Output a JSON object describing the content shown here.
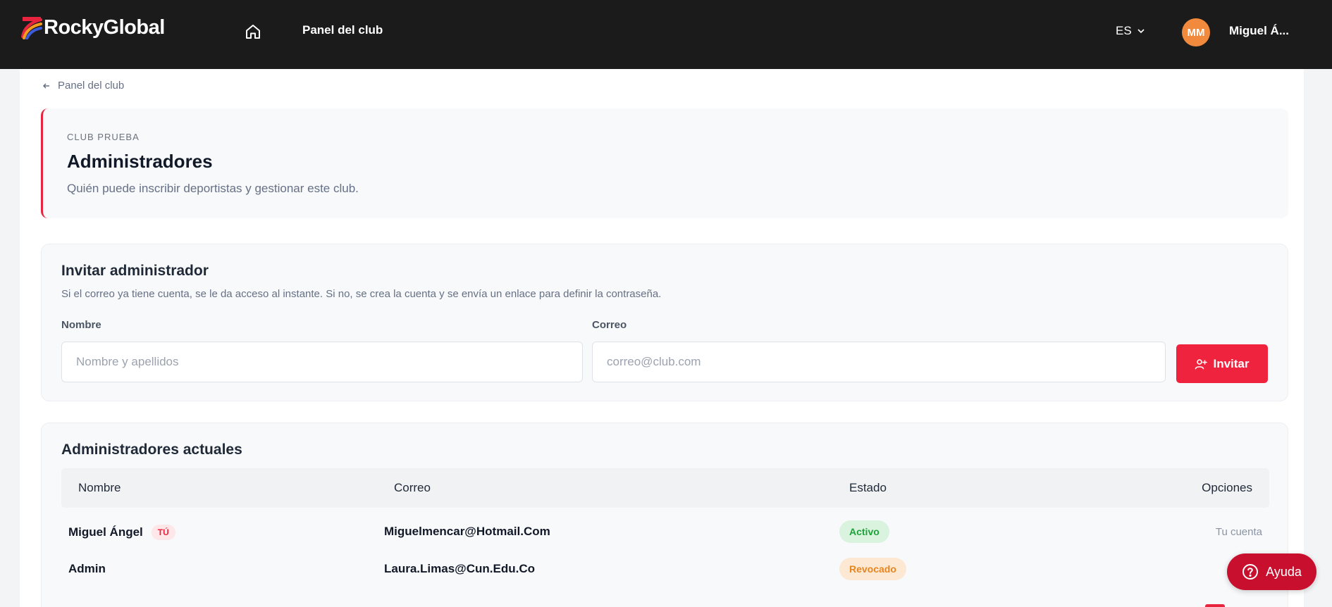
{
  "colors": {
    "topbar": "#1b1b1b",
    "accent": "#f0233e",
    "help": "#c8102e",
    "avatar": "#f28a3e",
    "active": "#1fa23a",
    "revoked": "#e5861e"
  },
  "header": {
    "brand": "RockyGlobal",
    "home_icon": "home-icon",
    "nav_link": "Panel del club",
    "language": "ES",
    "avatar_initials": "MM",
    "user_name": "Miguel Á..."
  },
  "breadcrumb": {
    "label": "Panel del club"
  },
  "page": {
    "eyebrow": "CLUB PRUEBA",
    "title": "Administradores",
    "subtitle": "Quién puede inscribir deportistas y gestionar este club."
  },
  "invite": {
    "title": "Invitar administrador",
    "description": "Si el correo ya tiene cuenta, se le da acceso al instante. Si no, se crea la cuenta y se envía un enlace para definir la contraseña.",
    "name_label": "Nombre",
    "name_placeholder": "Nombre y apellidos",
    "email_label": "Correo",
    "email_placeholder": "correo@club.com",
    "button_label": "Invitar"
  },
  "admins": {
    "title": "Administradores actuales",
    "columns": [
      "Nombre",
      "Correo",
      "Estado",
      "Opciones"
    ],
    "rows": [
      {
        "name": "Miguel Ángel",
        "badge": "TÚ",
        "email": "Miguelmencar@Hotmail.Com",
        "status": "Activo",
        "option": "Tu cuenta"
      },
      {
        "name": "Admin",
        "badge": "",
        "email": "Laura.Limas@Cun.Edu.Co",
        "status": "Revocado",
        "option": ""
      }
    ]
  },
  "help": {
    "label": "Ayuda"
  }
}
